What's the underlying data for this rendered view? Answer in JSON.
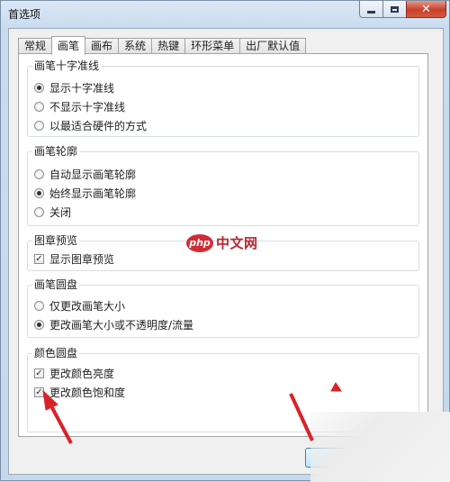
{
  "window": {
    "title": "首选项"
  },
  "tabs": [
    {
      "label": "常规",
      "active": false
    },
    {
      "label": "画笔",
      "active": true
    },
    {
      "label": "画布",
      "active": false
    },
    {
      "label": "系统",
      "active": false
    },
    {
      "label": "热键",
      "active": false
    },
    {
      "label": "环形菜单",
      "active": false
    },
    {
      "label": "出厂默认值",
      "active": false
    }
  ],
  "groups": {
    "crosshair": {
      "title": "画笔十字准线",
      "options": [
        {
          "label": "显示十字准线",
          "checked": true
        },
        {
          "label": "不显示十字准线",
          "checked": false
        },
        {
          "label": "以最适合硬件的方式",
          "checked": false
        }
      ]
    },
    "outline": {
      "title": "画笔轮廓",
      "options": [
        {
          "label": "自动显示画笔轮廓",
          "checked": false
        },
        {
          "label": "始终显示画笔轮廓",
          "checked": true
        },
        {
          "label": "关闭",
          "checked": false
        }
      ]
    },
    "stamp_preview": {
      "title": "图章预览",
      "options": [
        {
          "label": "显示图章预览",
          "checked": true
        }
      ]
    },
    "brush_circle": {
      "title": "画笔圆盘",
      "options": [
        {
          "label": "仅更改画笔大小",
          "checked": false
        },
        {
          "label": "更改画笔大小或不透明度/流量",
          "checked": true
        }
      ]
    },
    "color_circle": {
      "title": "颜色圆盘",
      "options": [
        {
          "label": "更改颜色亮度",
          "checked": true
        },
        {
          "label": "更改颜色饱和度",
          "checked": true
        }
      ]
    }
  },
  "watermark": {
    "logo": "php",
    "text": "中文网"
  },
  "colors": {
    "annotation_arrow": "#d9232b",
    "selected_tab_bg": "#ffffff",
    "panel_border": "#d5dfe5"
  },
  "icons": {
    "minimize": "minimize-icon",
    "maximize": "maximize-icon",
    "close": "close-icon"
  }
}
